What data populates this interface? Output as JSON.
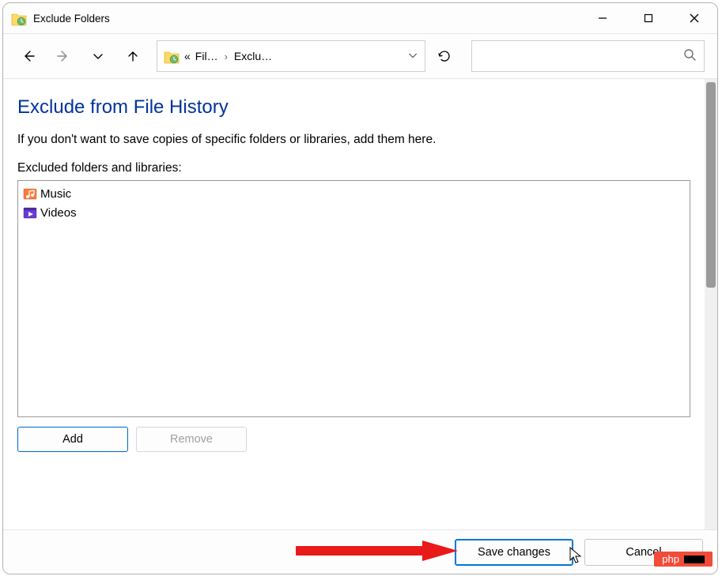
{
  "window": {
    "title": "Exclude Folders"
  },
  "breadcrumb": {
    "root_label": "Fil…",
    "current_label": "Exclu…"
  },
  "page": {
    "heading": "Exclude from File History",
    "description": "If you don't want to save copies of specific folders or libraries, add them here.",
    "list_label": "Excluded folders and libraries:"
  },
  "excluded_items": [
    {
      "name": "Music",
      "icon": "music-library-icon"
    },
    {
      "name": "Videos",
      "icon": "videos-library-icon"
    }
  ],
  "buttons": {
    "add": "Add",
    "remove": "Remove",
    "save": "Save changes",
    "cancel": "Cancel"
  },
  "watermark": {
    "text": "php"
  }
}
